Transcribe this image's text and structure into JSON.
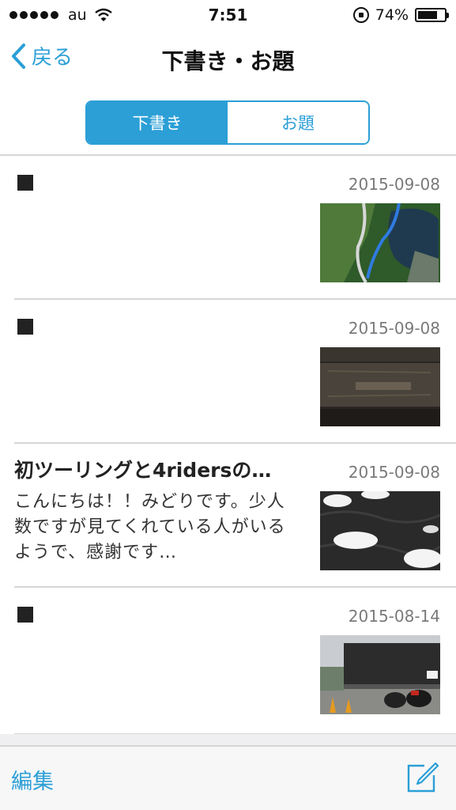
{
  "status_bar": {
    "carrier": "au",
    "time": "7:51",
    "battery_percent": "74%",
    "battery_level": 0.74,
    "icons": [
      "signal-dots-icon",
      "wifi-icon",
      "orientation-lock-icon",
      "battery-icon"
    ]
  },
  "nav": {
    "back_label": "戻る",
    "title": "下書き・お題"
  },
  "segments": {
    "drafts": "下書き",
    "topics": "お題",
    "selected": "drafts"
  },
  "posts": [
    {
      "title": "■",
      "excerpt": "",
      "date": "2015-09-08",
      "thumbnail": "lake-map-photo"
    },
    {
      "title": "■",
      "excerpt": "",
      "date": "2015-09-08",
      "thumbnail": "engine-stamp-photo"
    },
    {
      "title": "初ツーリングと4ridersの…",
      "excerpt": "こんにちは！！みどりです。少人数ですが見てくれている人がいるようで、感謝です…",
      "date": "2015-09-08",
      "thumbnail": "swans-photo"
    },
    {
      "title": "■",
      "excerpt": "",
      "date": "2015-08-14",
      "thumbnail": "motorcycles-garage-photo"
    }
  ],
  "toolbar": {
    "edit_label": "編集",
    "compose_icon": "compose-icon"
  },
  "colors": {
    "accent": "#2b9fd6",
    "divider": "#d6d6d6",
    "date_text": "#7a7a7a"
  }
}
